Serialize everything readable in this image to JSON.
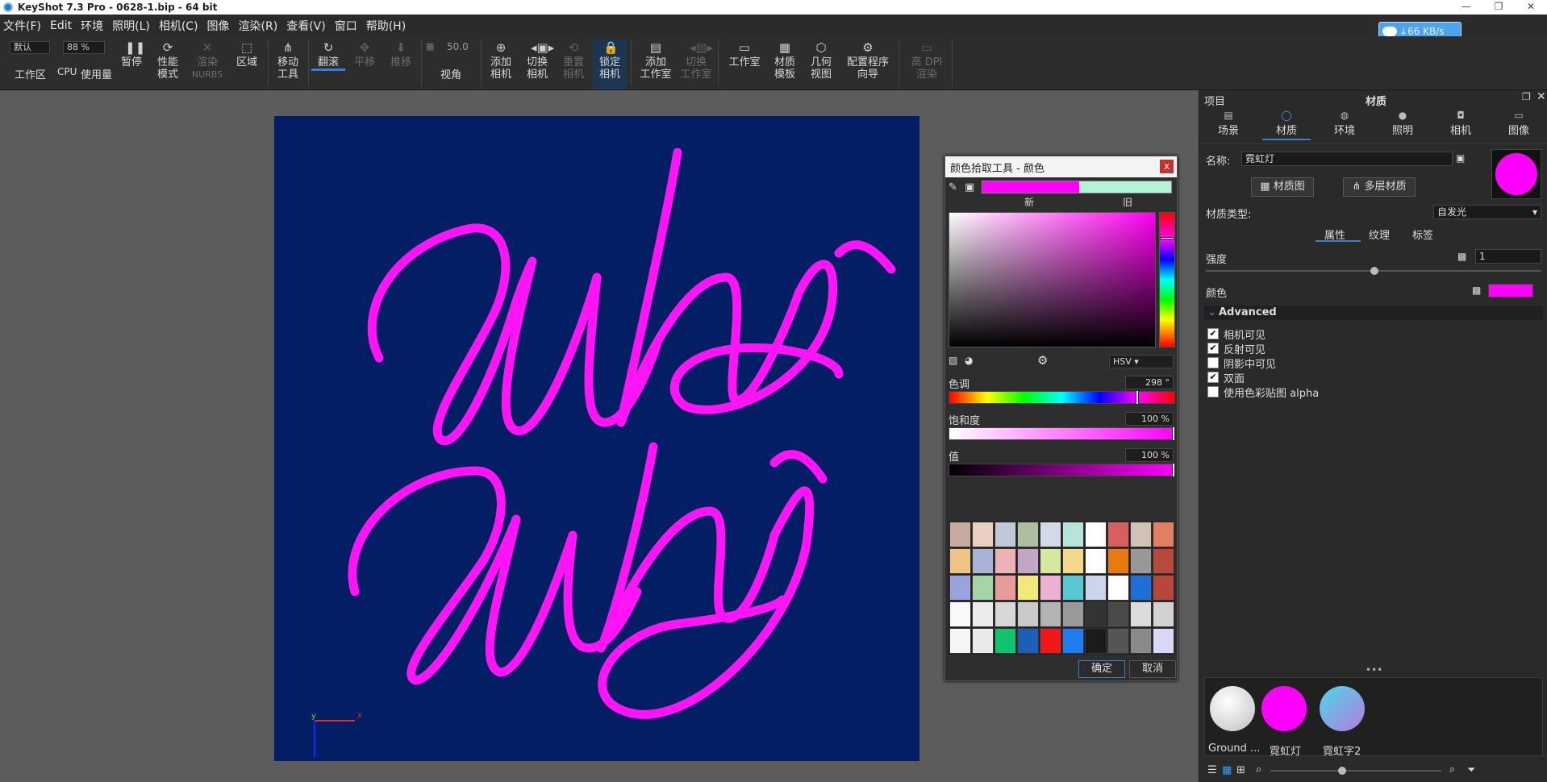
{
  "titlebar": {
    "title": "KeyShot 7.3 Pro  - 0628-1.bip  - 64 bit"
  },
  "menu": [
    "文件(F)",
    "Edit",
    "环境",
    "照明(L)",
    "相机(C)",
    "图像",
    "渲染(R)",
    "查看(V)",
    "窗口",
    "帮助(H)"
  ],
  "netspeed": "66 KB/s",
  "toolbar": {
    "preset": "默认",
    "zoom": "88 %",
    "fov": "50.0",
    "workspace": "工作区",
    "cpu": "CPU",
    "usage": "使用量",
    "pause": "暂停",
    "perf1": "性能",
    "perf2": "模式",
    "rnurbs1": "渲染",
    "rnurbs2": "NURBS",
    "region": "区域",
    "move1": "移动",
    "move2": "工具",
    "tumble": "翻滚",
    "pan": "平移",
    "dolly": "推移",
    "view": "视角",
    "addcam1": "添加",
    "addcam2": "相机",
    "switchcam1": "切换",
    "switchcam2": "相机",
    "resetcam1": "重置",
    "resetcam2": "相机",
    "lockcam1": "锁定",
    "lockcam2": "相机",
    "addstudio1": "添加",
    "addstudio2": "工作室",
    "switchstudio1": "切换",
    "switchstudio2": "工作室",
    "studio": "工作室",
    "mattpl1": "材质",
    "mattpl2": "模板",
    "geo1": "几何",
    "geo2": "视图",
    "wizard1": "配置程序",
    "wizard2": "向导",
    "hidpi1": "高 DPI",
    "hidpi2": "渲染"
  },
  "picker": {
    "title": "颜色拾取工具 - 颜色",
    "new_label": "新",
    "old_label": "旧",
    "mode": "HSV",
    "hue_label": "色调",
    "hue_value": "298 °",
    "sat_label": "饱和度",
    "sat_value": "100 %",
    "val_label": "值",
    "val_value": "100 %",
    "hue": 298,
    "saturation": 1.0,
    "value": 1.0,
    "ok": "确定",
    "cancel": "取消",
    "palette": [
      "#c8aa9e",
      "#e9d0c2",
      "#c0c9da",
      "#aebea0",
      "#d4d9ea",
      "#b8e3da",
      "#ffffff",
      "#d95f5f",
      "#cfc4b2",
      "#e08060",
      "#f0c387",
      "#aab2d8",
      "#eeb2b6",
      "#c3a5c8",
      "#d4e8a0",
      "#f5d98b",
      "#ffffff",
      "#e77a10",
      "#999898",
      "#b84a3d",
      "#9aa3dd",
      "#a3d5a5",
      "#e79c9c",
      "#f3e87a",
      "#eab1d4",
      "#59c8d2",
      "#c9d6ec",
      "#ffffff",
      "#1e6fd8",
      "#b6473b",
      "#f9f9f9",
      "#ececec",
      "#d8d8d8",
      "#c9c9c9",
      "#b3b3b3",
      "#9a9a9a",
      "#333333",
      "#4a4a4a",
      "#dcdcdc",
      "#d2d2d2",
      "#f6f6f6",
      "#eaeaea",
      "#0fc46c",
      "#1b5fb8",
      "#f01818",
      "#1f7df0",
      "#1b1b1b",
      "#555555",
      "#8a8a8a",
      "#d8d8f6"
    ]
  },
  "panel": {
    "project": "项目",
    "title": "材质",
    "tabs": [
      "场景",
      "材质",
      "环境",
      "照明",
      "相机",
      "图像"
    ],
    "name_label": "名称:",
    "name_value": "霓虹灯",
    "matgraph": "材质图",
    "multimat": "多层材质",
    "type_label": "材质类型:",
    "type_value": "自发光",
    "subtabs": [
      "属性",
      "纹理",
      "标签"
    ],
    "intensity_label": "强度",
    "intensity_value": "1",
    "color_label": "颜色",
    "color": "#ff00ff",
    "advanced": "Advanced",
    "checks": [
      {
        "label": "相机可见",
        "checked": true
      },
      {
        "label": "反射可见",
        "checked": true
      },
      {
        "label": "阴影中可见",
        "checked": false
      },
      {
        "label": "双面",
        "checked": true
      },
      {
        "label": "使用色彩贴图 alpha",
        "checked": false
      }
    ],
    "materials": [
      "Ground ...",
      "霓虹灯",
      "霓虹字2"
    ]
  }
}
